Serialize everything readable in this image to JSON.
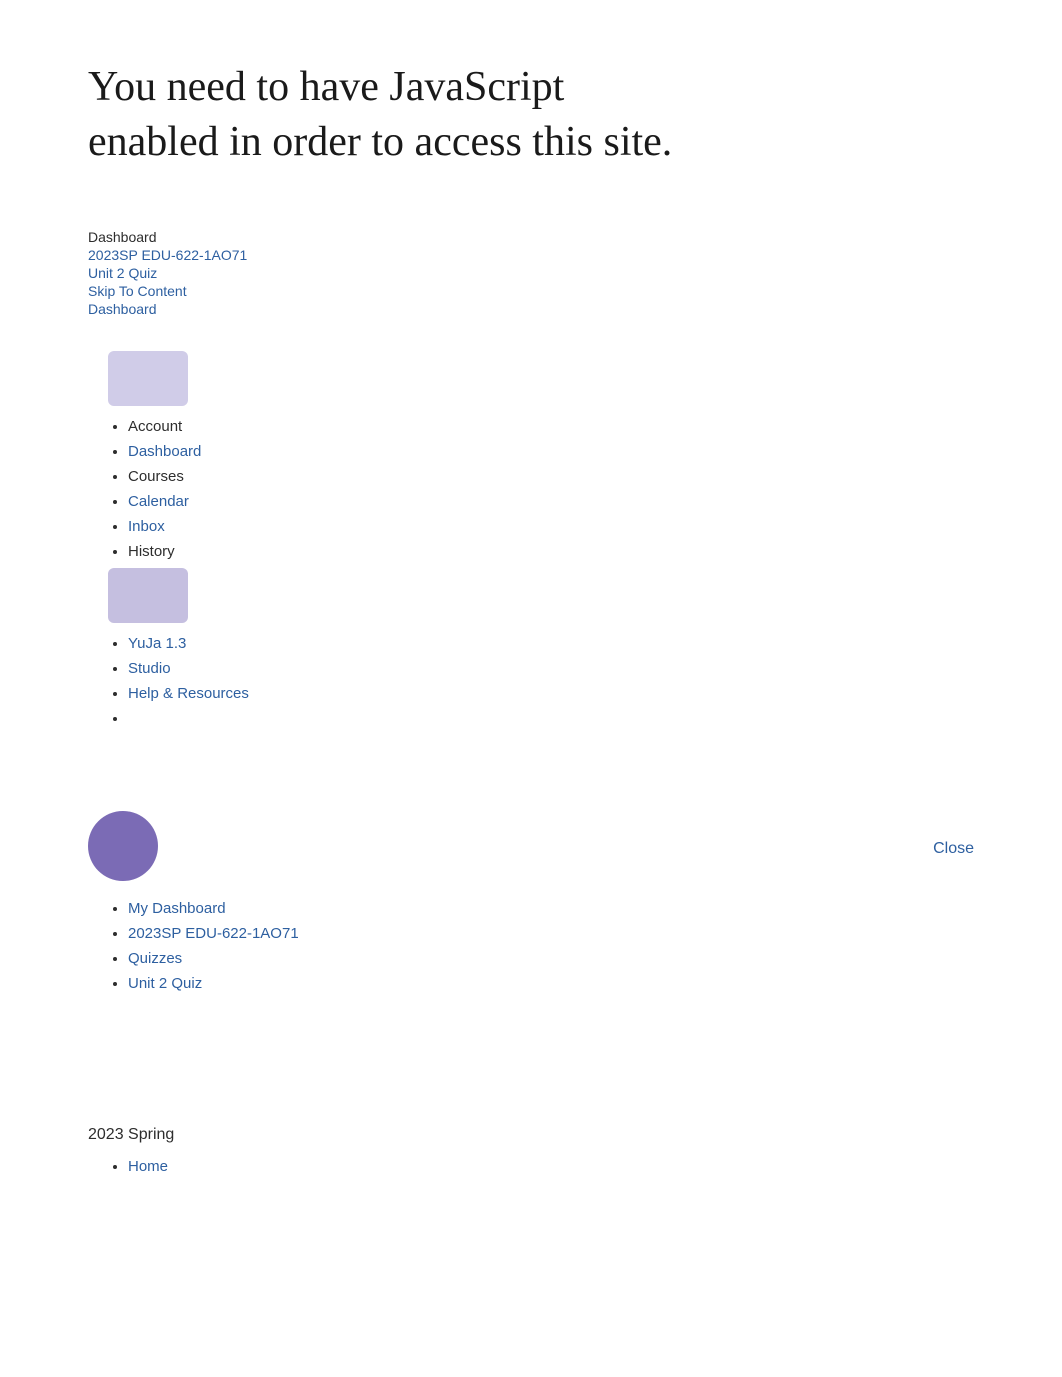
{
  "page": {
    "main_heading": "You need to have JavaScript enabled in order to access this site."
  },
  "breadcrumbs": {
    "dashboard_plain": "Dashboard",
    "course_link": "2023SP EDU-622-1AO71",
    "quiz_link": "Unit 2 Quiz",
    "skip_link": "Skip To Content",
    "dashboard_link": "Dashboard"
  },
  "global_nav": {
    "items": [
      {
        "label": "Account",
        "type": "plain",
        "icon": "account-icon"
      },
      {
        "label": "Dashboard",
        "type": "link"
      },
      {
        "label": "Courses",
        "type": "plain"
      },
      {
        "label": "Calendar",
        "type": "link"
      },
      {
        "label": "Inbox",
        "type": "link"
      },
      {
        "label": "History",
        "type": "plain"
      },
      {
        "label": "YuJa 1.3",
        "type": "link",
        "icon": "yuja-icon"
      },
      {
        "label": "Studio",
        "type": "link"
      },
      {
        "label": "Help & Resources",
        "type": "link"
      }
    ]
  },
  "close_button": {
    "label": "Close"
  },
  "user_menu": {
    "items": [
      {
        "label": "My Dashboard",
        "type": "link"
      },
      {
        "label": "2023SP EDU-622-1AO71",
        "type": "link"
      },
      {
        "label": "Quizzes",
        "type": "link"
      },
      {
        "label": "Unit 2 Quiz",
        "type": "link"
      }
    ]
  },
  "semester": {
    "title": "2023 Spring",
    "items": [
      {
        "label": "Home",
        "type": "link"
      }
    ]
  }
}
